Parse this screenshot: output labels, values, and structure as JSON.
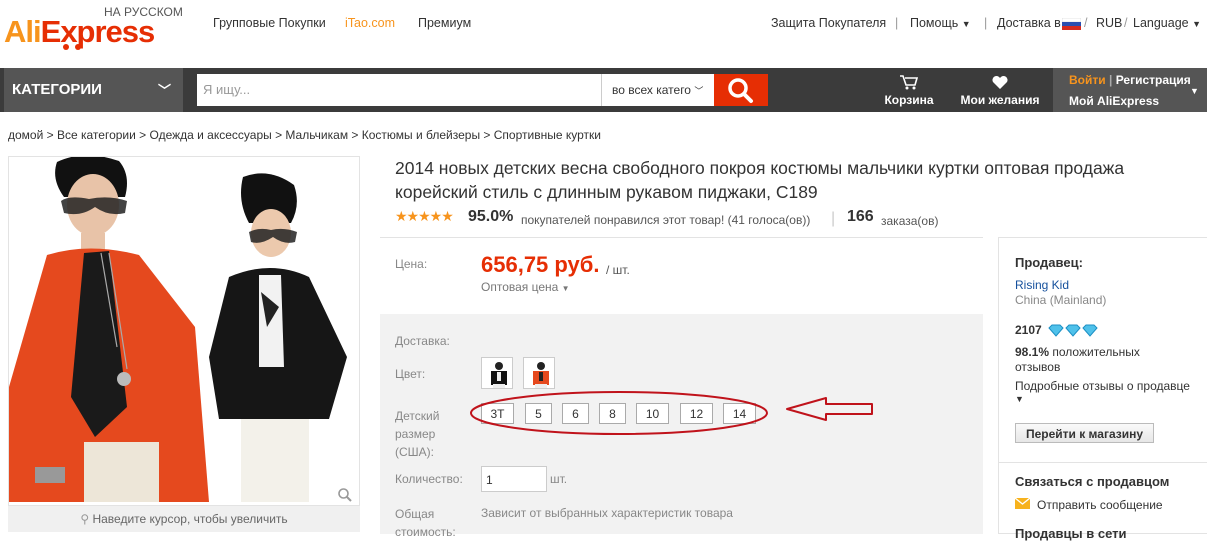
{
  "brand": {
    "ali": "Ali",
    "express": "xpress",
    "e_letter": "E",
    "lang_tag": "НА РУССКОМ"
  },
  "top_nav": {
    "left": [
      "Групповые Покупки",
      "iTao.com",
      "Премиум"
    ],
    "protection": "Защита Покупателя",
    "help": "Помощь",
    "delivery": "Доставка в",
    "currency": "RUB",
    "language": "Language"
  },
  "search_bar": {
    "categories_label": "КАТЕГОРИИ",
    "placeholder": "Я ищу...",
    "scope": "во всех катего",
    "cart": "Корзина",
    "wishlist": "Мои желания",
    "login": "Войти",
    "register": "Регистрация",
    "my_account": "Мой AliExpress"
  },
  "breadcrumb": "домой > Все категории > Одежда и аксессуары > Мальчикам > Костюмы и блейзеры > Спортивные куртки",
  "gallery": {
    "zoom_hint": "Наведите курсор, чтобы увеличить"
  },
  "product": {
    "title": "2014 новых детских весна свободного покроя костюмы мальчики куртки оптовая продажа корейский стиль с длинным рукавом пиджаки, C189",
    "rating_percent": "95.0%",
    "rating_text": "покупателей понравился этот товар! (41 голоса(ов))",
    "rating_stars": 4.8,
    "orders_count": "166",
    "orders_label": "заказа(ов)",
    "price_label": "Цена:",
    "price": "656,75 руб.",
    "price_unit": "/ шт.",
    "wholesale": "Оптовая цена",
    "shipping_label": "Доставка:",
    "color_label": "Цвет:",
    "size_label_1": "Детский",
    "size_label_2": "размер",
    "size_label_3": "(США):",
    "sizes": [
      "3T",
      "5",
      "6",
      "8",
      "10",
      "12",
      "14"
    ],
    "qty_label": "Количество:",
    "qty_value": "1",
    "qty_unit": "шт.",
    "total_label_1": "Общая",
    "total_label_2": "стоимость:",
    "total_value": "Зависит от выбранных характеристик товара"
  },
  "seller": {
    "heading": "Продавец:",
    "name": "Rising Kid",
    "country": "China (Mainland)",
    "score": "2107",
    "positive_percent": "98.1%",
    "positive_text_1": "положительных",
    "positive_text_2": "отзывов",
    "detailed": "Подробные отзывы о продавце",
    "store_button": "Перейти к магазину",
    "contact_heading": "Связаться с продавцом",
    "send_message": "Отправить сообщение",
    "more_heading": "Продавцы в сети"
  },
  "colors": {
    "accent": "#e62e04",
    "brand_orange": "#f7941d",
    "navbar": "#3b3b3b",
    "annotation": "#c0131b"
  }
}
